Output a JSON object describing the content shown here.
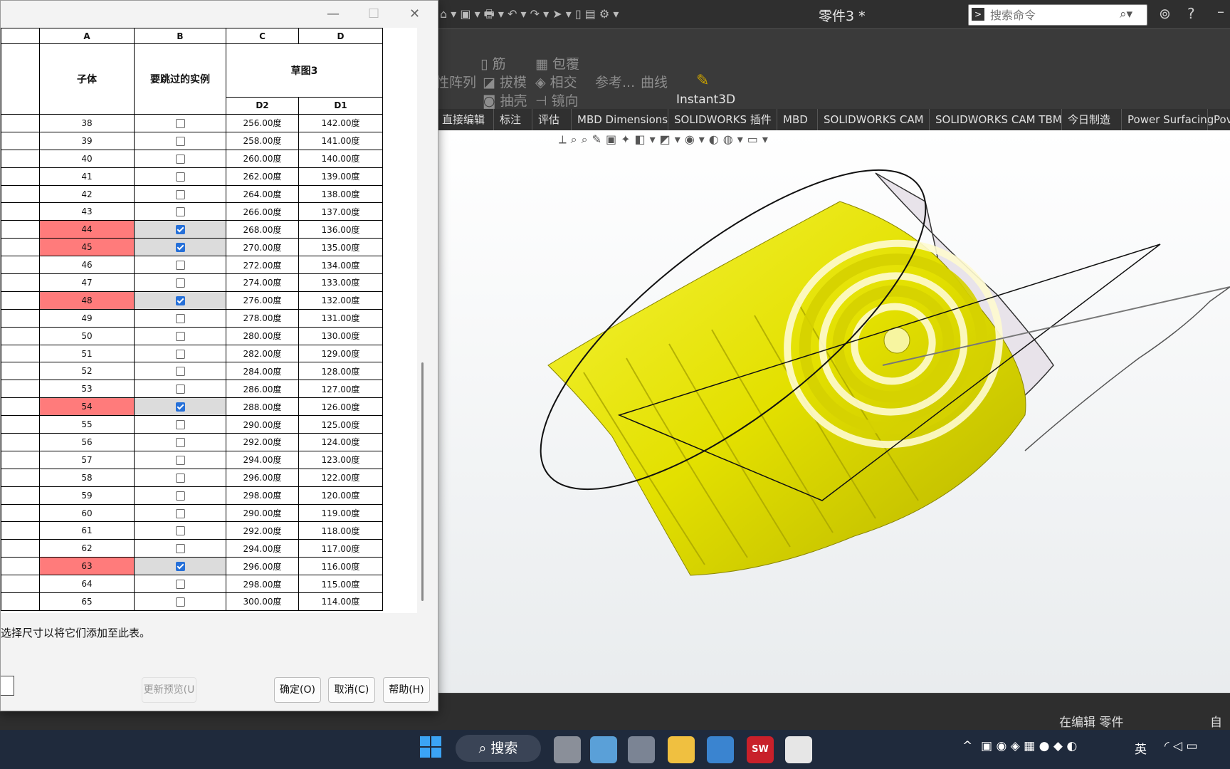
{
  "app": {
    "title": "零件3 *",
    "search_placeholder": "搜索命令",
    "ribbon": {
      "row1": [
        "筋",
        "包覆"
      ],
      "row2": [
        "性阵列",
        "拔模",
        "相交",
        "参考...",
        "曲线"
      ],
      "row3": [
        "抽壳",
        "镜向"
      ],
      "instant3d": "Instant3D"
    },
    "tabs": [
      "直接编辑",
      "标注",
      "评估",
      "MBD Dimensions",
      "SOLIDWORKS 插件",
      "MBD",
      "SOLIDWORKS CAM",
      "SOLIDWORKS CAM TBM",
      "今日制造",
      "Power Surfacing",
      "Pov"
    ],
    "status": "在编辑 零件",
    "status_right": "自定"
  },
  "dialog": {
    "columns": [
      "A",
      "B",
      "C",
      "D"
    ],
    "header": {
      "col_a": "子体",
      "col_b": "要跳过的实例",
      "col_cd": "草图3",
      "c_sub": "D2",
      "d_sub": "D1"
    },
    "rows": [
      {
        "n": "38",
        "skip": false,
        "d2": "256.00度",
        "d1": "142.00度"
      },
      {
        "n": "39",
        "skip": false,
        "d2": "258.00度",
        "d1": "141.00度"
      },
      {
        "n": "40",
        "skip": false,
        "d2": "260.00度",
        "d1": "140.00度"
      },
      {
        "n": "41",
        "skip": false,
        "d2": "262.00度",
        "d1": "139.00度"
      },
      {
        "n": "42",
        "skip": false,
        "d2": "264.00度",
        "d1": "138.00度"
      },
      {
        "n": "43",
        "skip": false,
        "d2": "266.00度",
        "d1": "137.00度"
      },
      {
        "n": "44",
        "skip": true,
        "d2": "268.00度",
        "d1": "136.00度"
      },
      {
        "n": "45",
        "skip": true,
        "d2": "270.00度",
        "d1": "135.00度"
      },
      {
        "n": "46",
        "skip": false,
        "d2": "272.00度",
        "d1": "134.00度"
      },
      {
        "n": "47",
        "skip": false,
        "d2": "274.00度",
        "d1": "133.00度"
      },
      {
        "n": "48",
        "skip": true,
        "d2": "276.00度",
        "d1": "132.00度"
      },
      {
        "n": "49",
        "skip": false,
        "d2": "278.00度",
        "d1": "131.00度"
      },
      {
        "n": "50",
        "skip": false,
        "d2": "280.00度",
        "d1": "130.00度"
      },
      {
        "n": "51",
        "skip": false,
        "d2": "282.00度",
        "d1": "129.00度"
      },
      {
        "n": "52",
        "skip": false,
        "d2": "284.00度",
        "d1": "128.00度"
      },
      {
        "n": "53",
        "skip": false,
        "d2": "286.00度",
        "d1": "127.00度"
      },
      {
        "n": "54",
        "skip": true,
        "d2": "288.00度",
        "d1": "126.00度"
      },
      {
        "n": "55",
        "skip": false,
        "d2": "290.00度",
        "d1": "125.00度"
      },
      {
        "n": "56",
        "skip": false,
        "d2": "292.00度",
        "d1": "124.00度"
      },
      {
        "n": "57",
        "skip": false,
        "d2": "294.00度",
        "d1": "123.00度"
      },
      {
        "n": "58",
        "skip": false,
        "d2": "296.00度",
        "d1": "122.00度"
      },
      {
        "n": "59",
        "skip": false,
        "d2": "298.00度",
        "d1": "120.00度"
      },
      {
        "n": "60",
        "skip": false,
        "d2": "290.00度",
        "d1": "119.00度"
      },
      {
        "n": "61",
        "skip": false,
        "d2": "292.00度",
        "d1": "118.00度"
      },
      {
        "n": "62",
        "skip": false,
        "d2": "294.00度",
        "d1": "117.00度"
      },
      {
        "n": "63",
        "skip": true,
        "d2": "296.00度",
        "d1": "116.00度"
      },
      {
        "n": "64",
        "skip": false,
        "d2": "298.00度",
        "d1": "115.00度"
      },
      {
        "n": "65",
        "skip": false,
        "d2": "300.00度",
        "d1": "114.00度"
      }
    ],
    "hint": "选择尺寸以将它们添加至此表。",
    "buttons": {
      "preview": "更新预览(U",
      "ok": "确定(O)",
      "cancel": "取消(C)",
      "help": "帮助(H)"
    }
  },
  "taskbar": {
    "search": "搜索",
    "ime": "英"
  },
  "colors": {
    "selected_row": "#ff7b7b",
    "model_yellow": "#e8e600",
    "checkbox_on": "#2670d8"
  }
}
